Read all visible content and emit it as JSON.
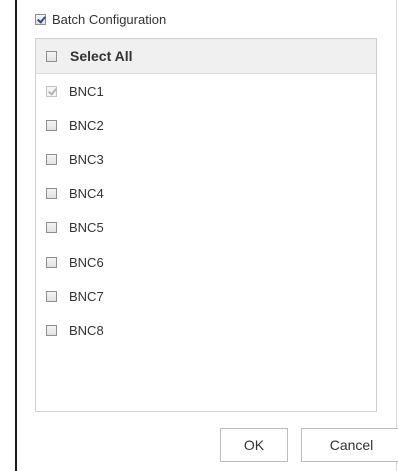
{
  "batch": {
    "label": "Batch Configuration",
    "checked": true
  },
  "list": {
    "select_all_label": "Select All",
    "select_all_checked": false,
    "items": [
      {
        "label": "BNC1",
        "checked": true,
        "disabled": true
      },
      {
        "label": "BNC2",
        "checked": false,
        "disabled": false
      },
      {
        "label": "BNC3",
        "checked": false,
        "disabled": false
      },
      {
        "label": "BNC4",
        "checked": false,
        "disabled": false
      },
      {
        "label": "BNC5",
        "checked": false,
        "disabled": false
      },
      {
        "label": "BNC6",
        "checked": false,
        "disabled": false
      },
      {
        "label": "BNC7",
        "checked": false,
        "disabled": false
      },
      {
        "label": "BNC8",
        "checked": false,
        "disabled": false
      }
    ]
  },
  "buttons": {
    "ok_label": "OK",
    "cancel_label": "Cancel"
  }
}
